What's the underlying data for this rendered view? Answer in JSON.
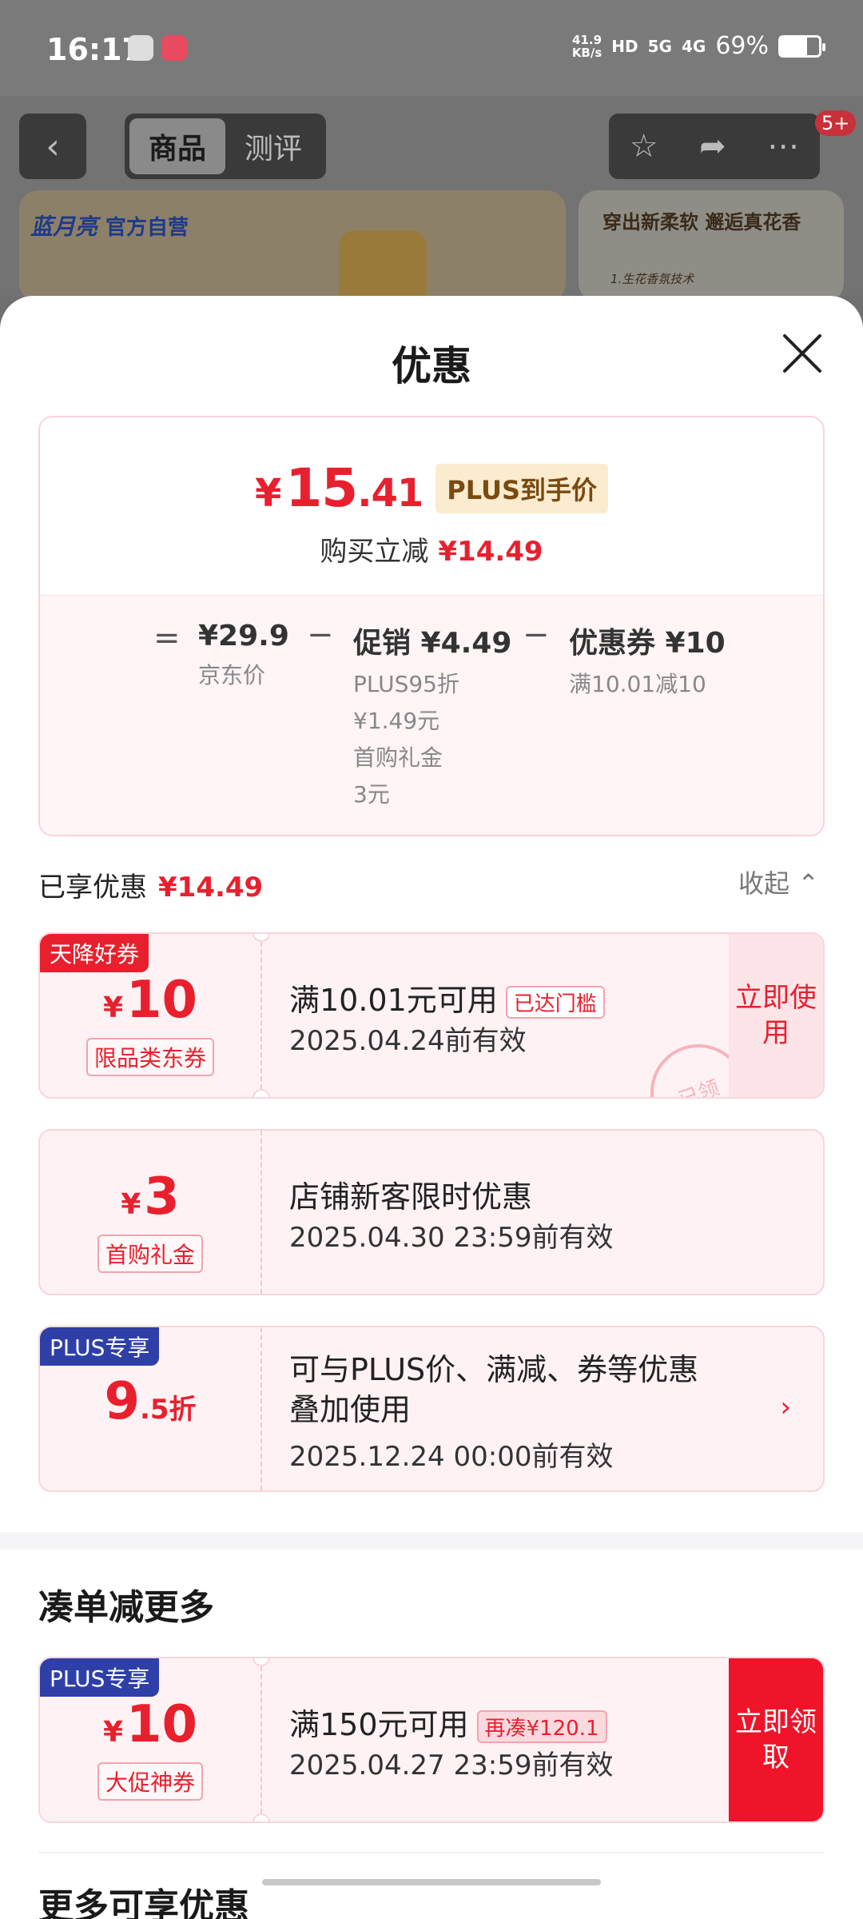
{
  "status_bar": {
    "time": "16:17",
    "net_speed_value": "41.9",
    "net_speed_unit": "KB/s",
    "hd": "HD",
    "sig1": "5G",
    "sig2": "4G",
    "battery": "69%",
    "battery_level": 0.69
  },
  "header": {
    "tabs": [
      "商品",
      "测评"
    ],
    "badge": "5+"
  },
  "banner": {
    "brand": "蓝月亮",
    "official": "官方自营",
    "slogan": "穿出新柔软 邂逅真花香",
    "tech": "1.生花香氛技术"
  },
  "sheet": {
    "title": "优惠",
    "price": {
      "yen": "¥",
      "int": "15",
      "dec": ".41",
      "plus_tag": "PLUS到手价",
      "instant_label": "购买立减",
      "instant_amount": "¥14.49"
    },
    "breakdown": {
      "eq": "=",
      "minus": "−",
      "jd_price": "¥29.9",
      "jd_price_label": "京东价",
      "promo_main": "促销 ¥4.49",
      "promo_sub1": "PLUS95折",
      "promo_sub2": "¥1.49元",
      "promo_sub3": "首购礼金",
      "promo_sub4": "3元",
      "coupon_main": "优惠券 ¥10",
      "coupon_sub": "满10.01减10"
    },
    "enjoyed_label": "已享优惠",
    "enjoyed_amount": "¥14.49",
    "collapse": "收起",
    "coupons": [
      {
        "corner": "天降好券",
        "yen": "¥",
        "num": "10",
        "type": "限品类东券",
        "line1": "满10.01元可用",
        "tag": "已达门槛",
        "line2": "2025.04.24前有效",
        "action": "立即使用",
        "stamp": "已领"
      },
      {
        "yen": "¥",
        "num": "3",
        "type": "首购礼金",
        "line1": "店铺新客限时优惠",
        "line2": "2025.04.30 23:59前有效"
      },
      {
        "corner": "PLUS专享",
        "num": "9",
        "suffix": ".5折",
        "line1": "可与PLUS价、满减、券等优惠",
        "line1b": "叠加使用",
        "line2": "2025.12.24 00:00前有效"
      }
    ],
    "more_section": {
      "title": "凑单减更多",
      "coupon": {
        "corner": "PLUS专享",
        "yen": "¥",
        "num": "10",
        "type": "大促神券",
        "line1": "满150元可用",
        "tag": "再凑¥120.1",
        "line2": "2025.04.27 23:59前有效",
        "action": "立即领取"
      }
    },
    "more_title": "更多可享优惠"
  }
}
